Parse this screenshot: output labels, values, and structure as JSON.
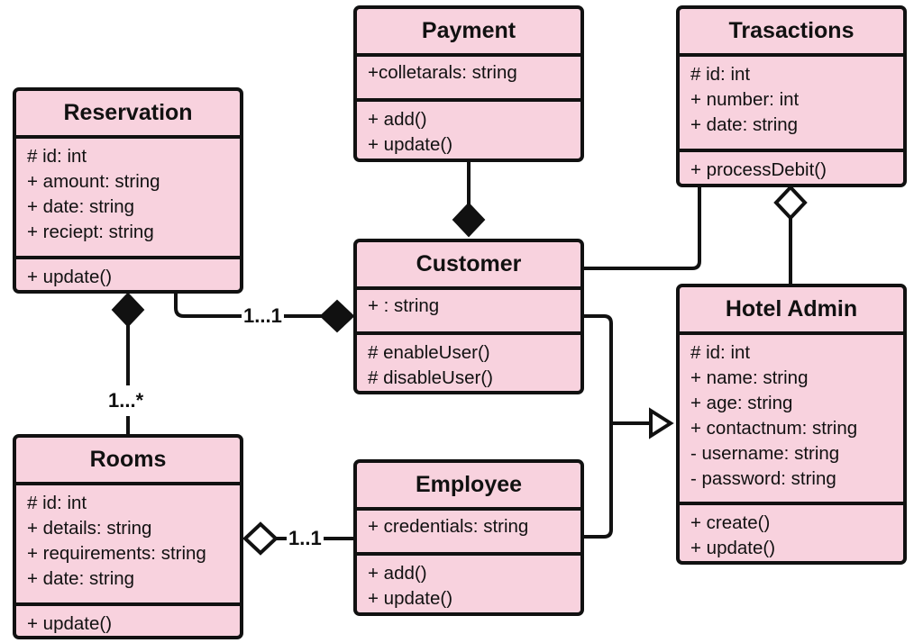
{
  "diagram": {
    "type": "uml-class-diagram",
    "fill_color": "#f8d2de",
    "stroke_color": "#111111",
    "classes": {
      "reservation": {
        "name": "Reservation",
        "attributes": [
          "# id: int",
          "+ amount: string",
          "+ date: string",
          "+ reciept: string"
        ],
        "operations": [
          "+ update()"
        ]
      },
      "payment": {
        "name": "Payment",
        "attributes": [
          "+colletarals: string"
        ],
        "operations": [
          "+ add()",
          "+ update()"
        ]
      },
      "transactions": {
        "name": "Trasactions",
        "attributes": [
          "# id: int",
          "+ number: int",
          "+ date: string"
        ],
        "operations": [
          "+ processDebit()"
        ]
      },
      "customer": {
        "name": "Customer",
        "attributes": [
          "+ : string"
        ],
        "operations": [
          "# enableUser()",
          "# disableUser()"
        ]
      },
      "hotel_admin": {
        "name": "Hotel Admin",
        "attributes": [
          "# id: int",
          "+ name: string",
          "+ age: string",
          "+ contactnum: string",
          "- username: string",
          "- password: string"
        ],
        "operations": [
          "+ create()",
          "+ update()"
        ]
      },
      "rooms": {
        "name": "Rooms",
        "attributes": [
          "# id: int",
          "+ details: string",
          "+ requirements: string",
          "+ date: string"
        ],
        "operations": [
          "+ update()"
        ]
      },
      "employee": {
        "name": "Employee",
        "attributes": [
          "+ credentials: string"
        ],
        "operations": [
          "+ add()",
          "+ update()"
        ]
      }
    },
    "relationships": [
      {
        "from": "Payment",
        "to": "Customer",
        "kind": "composition",
        "label": ""
      },
      {
        "from": "Reservation",
        "to": "Customer",
        "kind": "composition",
        "label": "1...1"
      },
      {
        "from": "Rooms",
        "to": "Reservation",
        "kind": "composition",
        "label": "1...*"
      },
      {
        "from": "Employee",
        "to": "Rooms",
        "kind": "aggregation",
        "label": "1..1"
      },
      {
        "from": "Hotel Admin",
        "to": "Trasactions",
        "kind": "aggregation",
        "label": ""
      },
      {
        "from": "Customer",
        "to": "Trasactions",
        "kind": "association",
        "label": ""
      },
      {
        "from": "Customer",
        "to": "Hotel Admin",
        "kind": "generalization",
        "label": ""
      },
      {
        "from": "Employee",
        "to": "Hotel Admin",
        "kind": "generalization",
        "label": ""
      }
    ],
    "labels": {
      "res_cust": "1...1",
      "res_rooms": "1...*",
      "rooms_emp": "1..1"
    }
  }
}
